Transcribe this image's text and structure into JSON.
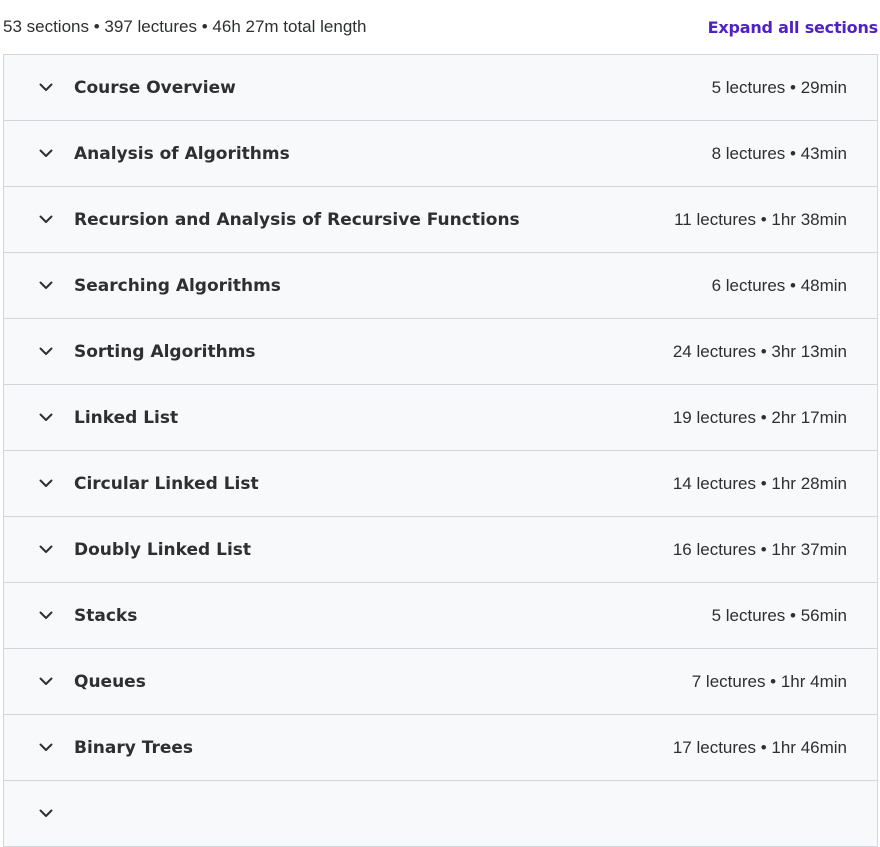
{
  "header": {
    "summary": "53 sections • 397 lectures • 46h 27m total length",
    "expand_label": "Expand all sections"
  },
  "sections": [
    {
      "title": "Course Overview",
      "meta": "5 lectures • 29min"
    },
    {
      "title": "Analysis of Algorithms",
      "meta": "8 lectures • 43min"
    },
    {
      "title": "Recursion and Analysis of Recursive Functions",
      "meta": "11 lectures • 1hr 38min"
    },
    {
      "title": "Searching Algorithms",
      "meta": "6 lectures • 48min"
    },
    {
      "title": "Sorting Algorithms",
      "meta": "24 lectures • 3hr 13min"
    },
    {
      "title": "Linked List",
      "meta": "19 lectures • 2hr 17min"
    },
    {
      "title": "Circular Linked List",
      "meta": "14 lectures • 1hr 28min"
    },
    {
      "title": "Doubly Linked List",
      "meta": "16 lectures • 1hr 37min"
    },
    {
      "title": "Stacks",
      "meta": "5 lectures • 56min"
    },
    {
      "title": "Queues",
      "meta": "7 lectures • 1hr 4min"
    },
    {
      "title": "Binary Trees",
      "meta": "17 lectures • 1hr 46min"
    },
    {
      "title": "",
      "meta": ""
    }
  ],
  "icons": {
    "chevron": "chevron-down-icon"
  },
  "colors": {
    "accent": "#5022c3",
    "section_bg": "#f7f9fa",
    "border": "#d1d7dc",
    "text": "#2d2f31"
  }
}
